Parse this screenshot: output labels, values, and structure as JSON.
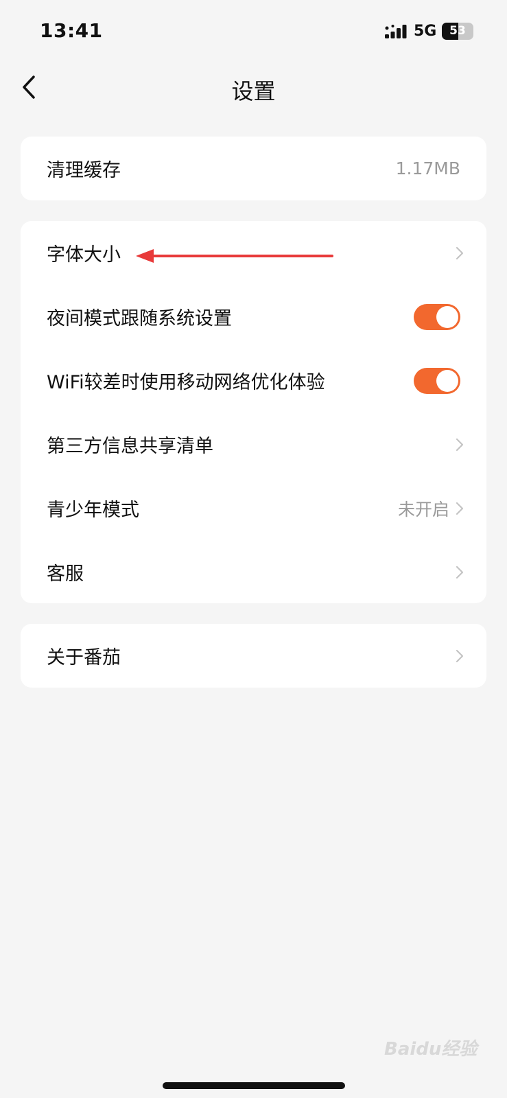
{
  "status_bar": {
    "time": "13:41",
    "network": "5G",
    "battery": "53",
    "battery_level_percent": 53
  },
  "nav": {
    "title": "设置"
  },
  "cache_card": {
    "label": "清理缓存",
    "value": "1.17MB"
  },
  "settings": {
    "font_size_label": "字体大小",
    "night_mode_label": "夜间模式跟随系统设置",
    "night_mode_on": true,
    "wifi_opt_label": "WiFi较差时使用移动网络优化体验",
    "wifi_opt_on": true,
    "third_party_label": "第三方信息共享清单",
    "youth_mode_label": "青少年模式",
    "youth_mode_value": "未开启",
    "customer_service_label": "客服"
  },
  "about_card": {
    "label": "关于番茄"
  },
  "watermark": {
    "text": "Baidu经验"
  },
  "colors": {
    "accent": "#f2682e",
    "annotation_arrow": "#e83a3a",
    "background": "#f5f5f5"
  }
}
